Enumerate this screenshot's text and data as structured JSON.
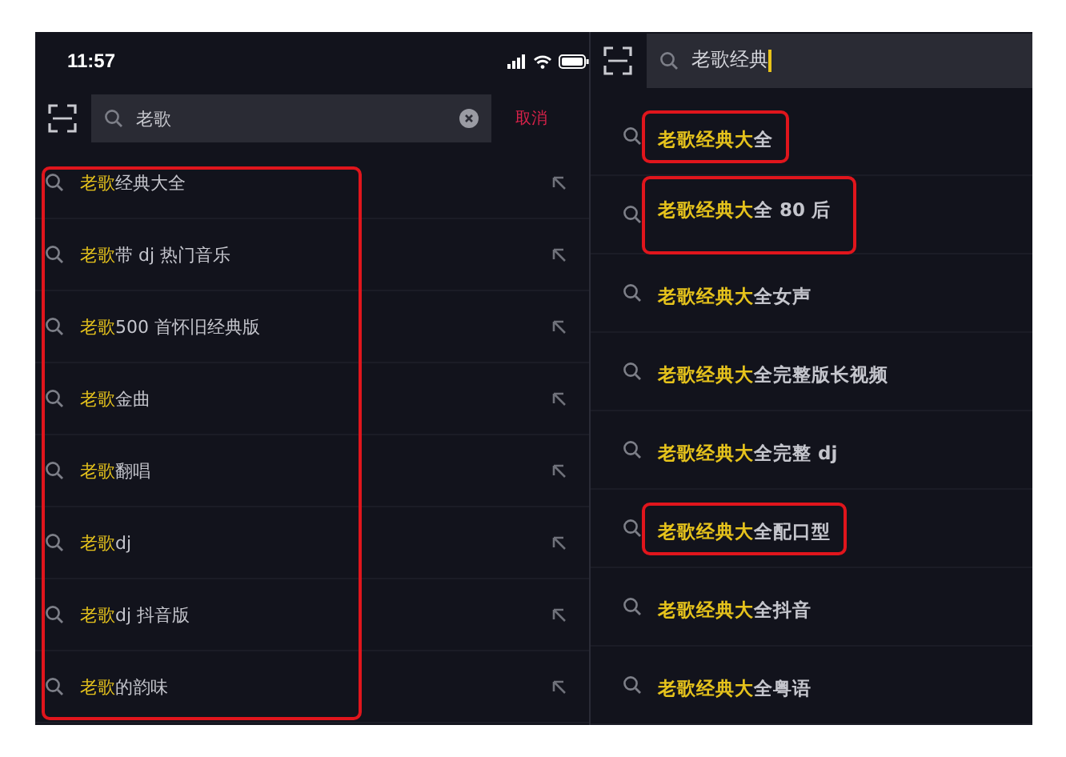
{
  "left_screen": {
    "status_bar": {
      "time": "11:57"
    },
    "search": {
      "value": "老歌",
      "cancel": "取消"
    },
    "suggestions_annotated": true,
    "suggestions": [
      {
        "match": "老歌",
        "rest": "经典大全"
      },
      {
        "match": "老歌",
        "rest": "带 dj 热门音乐"
      },
      {
        "match": "老歌",
        "rest": "500 首怀旧经典版"
      },
      {
        "match": "老歌",
        "rest": "金曲"
      },
      {
        "match": "老歌",
        "rest": "翻唱"
      },
      {
        "match": "老歌",
        "rest": "dj"
      },
      {
        "match": "老歌",
        "rest": "dj 抖音版"
      },
      {
        "match": "老歌",
        "rest": "的韵味"
      }
    ]
  },
  "right_screen": {
    "search": {
      "value": "老歌经典"
    },
    "suggestions": [
      {
        "match": "老歌经典大",
        "rest": "全",
        "annotated": true
      },
      {
        "match": "老歌经典大",
        "rest": "全 80 后",
        "annotated": true
      },
      {
        "match": "老歌经典大",
        "rest": "全女声",
        "annotated": false
      },
      {
        "match": "老歌经典大",
        "rest": "全完整版长视频",
        "annotated": false
      },
      {
        "match": "老歌经典大",
        "rest": "全完整 dj",
        "annotated": false
      },
      {
        "match": "老歌经典大",
        "rest": "全配口型",
        "annotated": true
      },
      {
        "match": "老歌经典大",
        "rest": "全抖音",
        "annotated": false
      },
      {
        "match": "老歌经典大",
        "rest": "全粤语",
        "annotated": false
      }
    ]
  }
}
